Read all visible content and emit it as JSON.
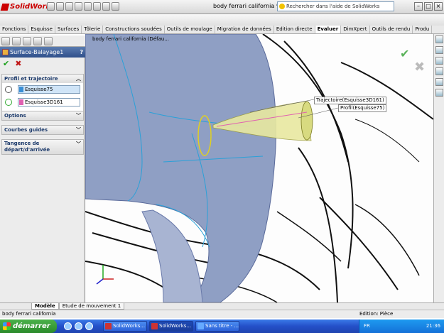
{
  "app": {
    "name": "SolidWorks",
    "document_title": "body ferrari california *",
    "search_placeholder": "Rechercher dans l'aide de SolidWorks"
  },
  "tabs": [
    {
      "label": "Fonctions"
    },
    {
      "label": "Esquisse"
    },
    {
      "label": "Surfaces"
    },
    {
      "label": "Tôlerie"
    },
    {
      "label": "Constructions soudées"
    },
    {
      "label": "Outils de moulage"
    },
    {
      "label": "Migration de données"
    },
    {
      "label": "Edition directe"
    },
    {
      "label": "Evaluer",
      "active": true
    },
    {
      "label": "DimXpert"
    },
    {
      "label": "Outils de rendu"
    },
    {
      "label": "Produ"
    }
  ],
  "feature_panel": {
    "title": "Surface-Balayage1",
    "help_label": "?",
    "ok_symbol": "✔",
    "cancel_symbol": "✖",
    "profile_section": {
      "heading": "Profil et trajectoire",
      "profile_value": "Esquisse75",
      "path_value": "Esquisse3D161",
      "profile_color": "#3a8fd6",
      "path_color": "#e060b0"
    },
    "options_heading": "Options",
    "guides_heading": "Courbes guides",
    "tangency_heading": "Tangence de départ/d'arrivée"
  },
  "viewport": {
    "tree_label": "body ferrari california (Défau...",
    "callouts": {
      "trajectory": "Trajectoire(Esquisse3D161)",
      "profile": "Profil(Esquisse75)"
    }
  },
  "bottom_tabs": [
    {
      "label": "Modèle",
      "active": true
    },
    {
      "label": "Etude de mouvement 1",
      "active": false
    }
  ],
  "status": {
    "left": "body ferrari california",
    "right": "Edition: Pièce"
  },
  "taskbar": {
    "start_label": "démarrer",
    "windows": [
      {
        "label": "SolidWorks...",
        "active": false
      },
      {
        "label": "SolidWorks...",
        "active": true
      },
      {
        "label": "Sans titre - ...",
        "active": false
      }
    ],
    "language": "FR",
    "time": "21:36"
  },
  "colors": {
    "surface": "#8f9fc4",
    "accent": "#2f4f8a",
    "taskbar": "#2450c8"
  }
}
